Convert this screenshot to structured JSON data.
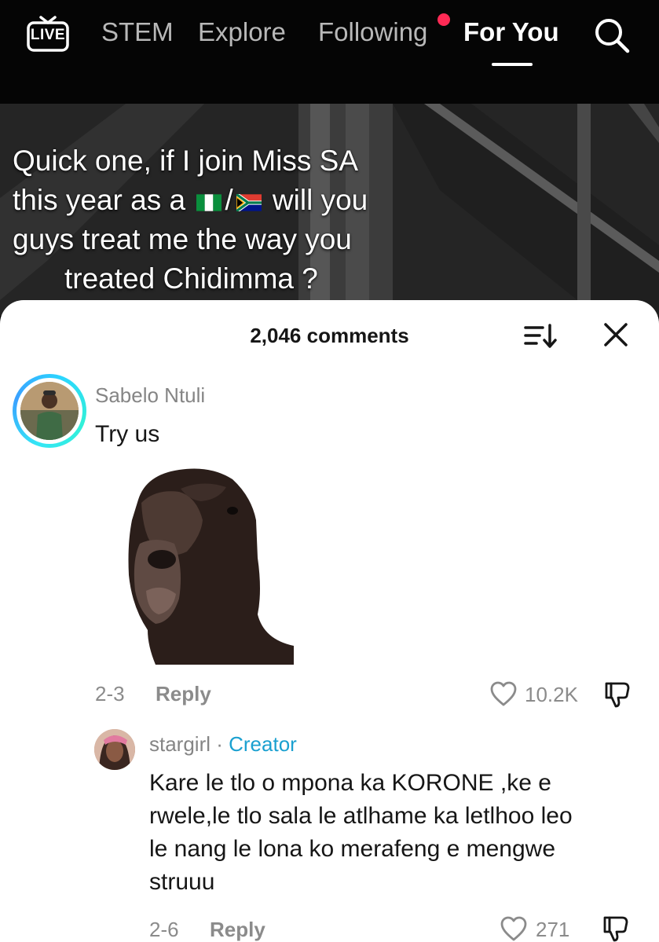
{
  "nav": {
    "live_label": "LIVE",
    "tabs": [
      {
        "label": "STEM",
        "active": false
      },
      {
        "label": "Explore",
        "active": false
      },
      {
        "label": "Following",
        "active": false,
        "has_dot": true
      },
      {
        "label": "For You",
        "active": true
      }
    ],
    "search_icon": "search-icon",
    "dot_color": "#ff2a55"
  },
  "video": {
    "caption_lines": [
      "Quick one, if I join Miss SA",
      "will you",
      "guys treat me the way you",
      "treated Chidimma ?"
    ],
    "caption_prefix_line2": "this year as a",
    "caption_flags": [
      "nigeria-flag",
      "south-africa-flag"
    ],
    "flag_separator": "/"
  },
  "comments_sheet": {
    "title": "2,046 comments",
    "sort_icon": "sort-icon",
    "close_icon": "close-icon",
    "comments": [
      {
        "username": "Sabelo Ntuli",
        "text": "Try us",
        "sticker": "goat-sticker",
        "date": "2-3",
        "reply_label": "Reply",
        "likes": "10.2K"
      },
      {
        "username": "stargirl",
        "separator": " · ",
        "badge": "Creator",
        "text_lines": [
          "Kare le tlo o mpona ka KORONE ,ke e",
          "rwele,le tlo sala le atlhame ka letlhoo leo",
          "le nang le lona ko merafeng e mengwe",
          "struuu"
        ],
        "date": "2-6",
        "reply_label": "Reply",
        "likes": "271"
      }
    ]
  },
  "colors": {
    "accent_ring": "#34e6f5",
    "creator_badge": "#1aa0d0",
    "nav_bg": "#050505"
  }
}
